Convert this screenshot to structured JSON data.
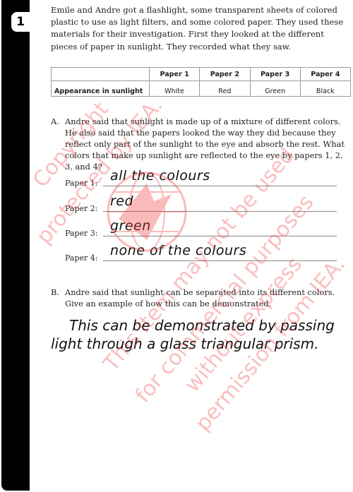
{
  "question_number": "1",
  "intro": "Emile and Andre got a flashlight, some transparent sheets of colored plastic to use as light filters, and some colored paper. They used these materials for their investigation. First they looked at the different pieces of paper in sunlight. They recorded what they saw.",
  "table": {
    "columns": [
      "",
      "Paper 1",
      "Paper 2",
      "Paper 3",
      "Paper 4"
    ],
    "rows": [
      {
        "label": "Appearance in sunlight",
        "values": [
          "White",
          "Red",
          "Green",
          "Black"
        ]
      }
    ]
  },
  "part_a": {
    "label": "A.",
    "text": "Andre said that sunlight is made up of a mixture of different colors. He also said that the papers looked the way they did because they reflect only part of the sunlight to the eye and absorb the rest. What colors that make up sunlight are reflected to the eye by papers 1, 2, 3, and 4?",
    "answers": [
      {
        "label": "Paper 1:",
        "response": "all the colours"
      },
      {
        "label": "Paper 2:",
        "response": "red"
      },
      {
        "label": "Paper 3:",
        "response": "green"
      },
      {
        "label": "Paper 4:",
        "response": "none of the colours"
      }
    ]
  },
  "part_b": {
    "label": "B.",
    "text": "Andre said that sunlight can be separated into its different colors. Give an example of how this can be demonstrated.",
    "response_lines": [
      "This can be demonstrated by passing",
      "light through a glass triangular prism."
    ]
  },
  "watermark": {
    "lines": [
      "Copyright",
      "protected by IEA.",
      "This item may not be used",
      "for commercial purposes",
      "without express",
      "permission from IEA."
    ],
    "color": "#f03c3c"
  }
}
